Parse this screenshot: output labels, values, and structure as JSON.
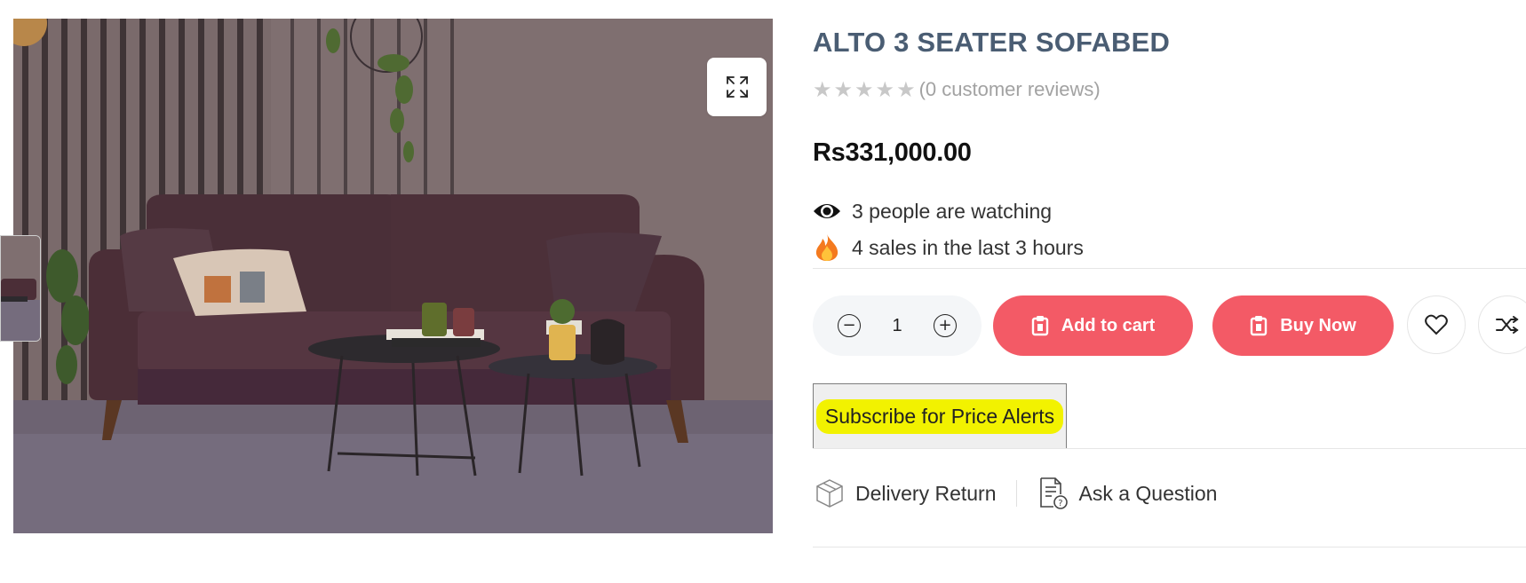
{
  "product": {
    "title": "ALTO 3 SEATER SOFABED",
    "rating_stars": 0,
    "reviews_text": "(0 customer reviews)",
    "price": "Rs331,000.00",
    "watching_text": "3 people are watching",
    "sales_text": "4 sales in the last 3 hours"
  },
  "actions": {
    "quantity": "1",
    "add_to_cart": "Add to cart",
    "buy_now": "Buy Now",
    "subscribe": "Subscribe for Price Alerts"
  },
  "links": {
    "delivery_return": "Delivery Return",
    "ask_question": "Ask a Question"
  },
  "icons": {
    "zoom": "expand-icon",
    "watching": "eye-icon",
    "sales": "fire-icon",
    "minus": "minus-circle-icon",
    "plus": "plus-circle-icon",
    "cart": "clipboard-icon",
    "wishlist": "heart-icon",
    "compare": "shuffle-icon",
    "delivery": "package-icon",
    "question": "document-question-icon"
  },
  "colors": {
    "title": "#4a5d73",
    "accent_red": "#f35a66",
    "highlight": "#f2f200",
    "star_empty": "#c8c8c8"
  }
}
